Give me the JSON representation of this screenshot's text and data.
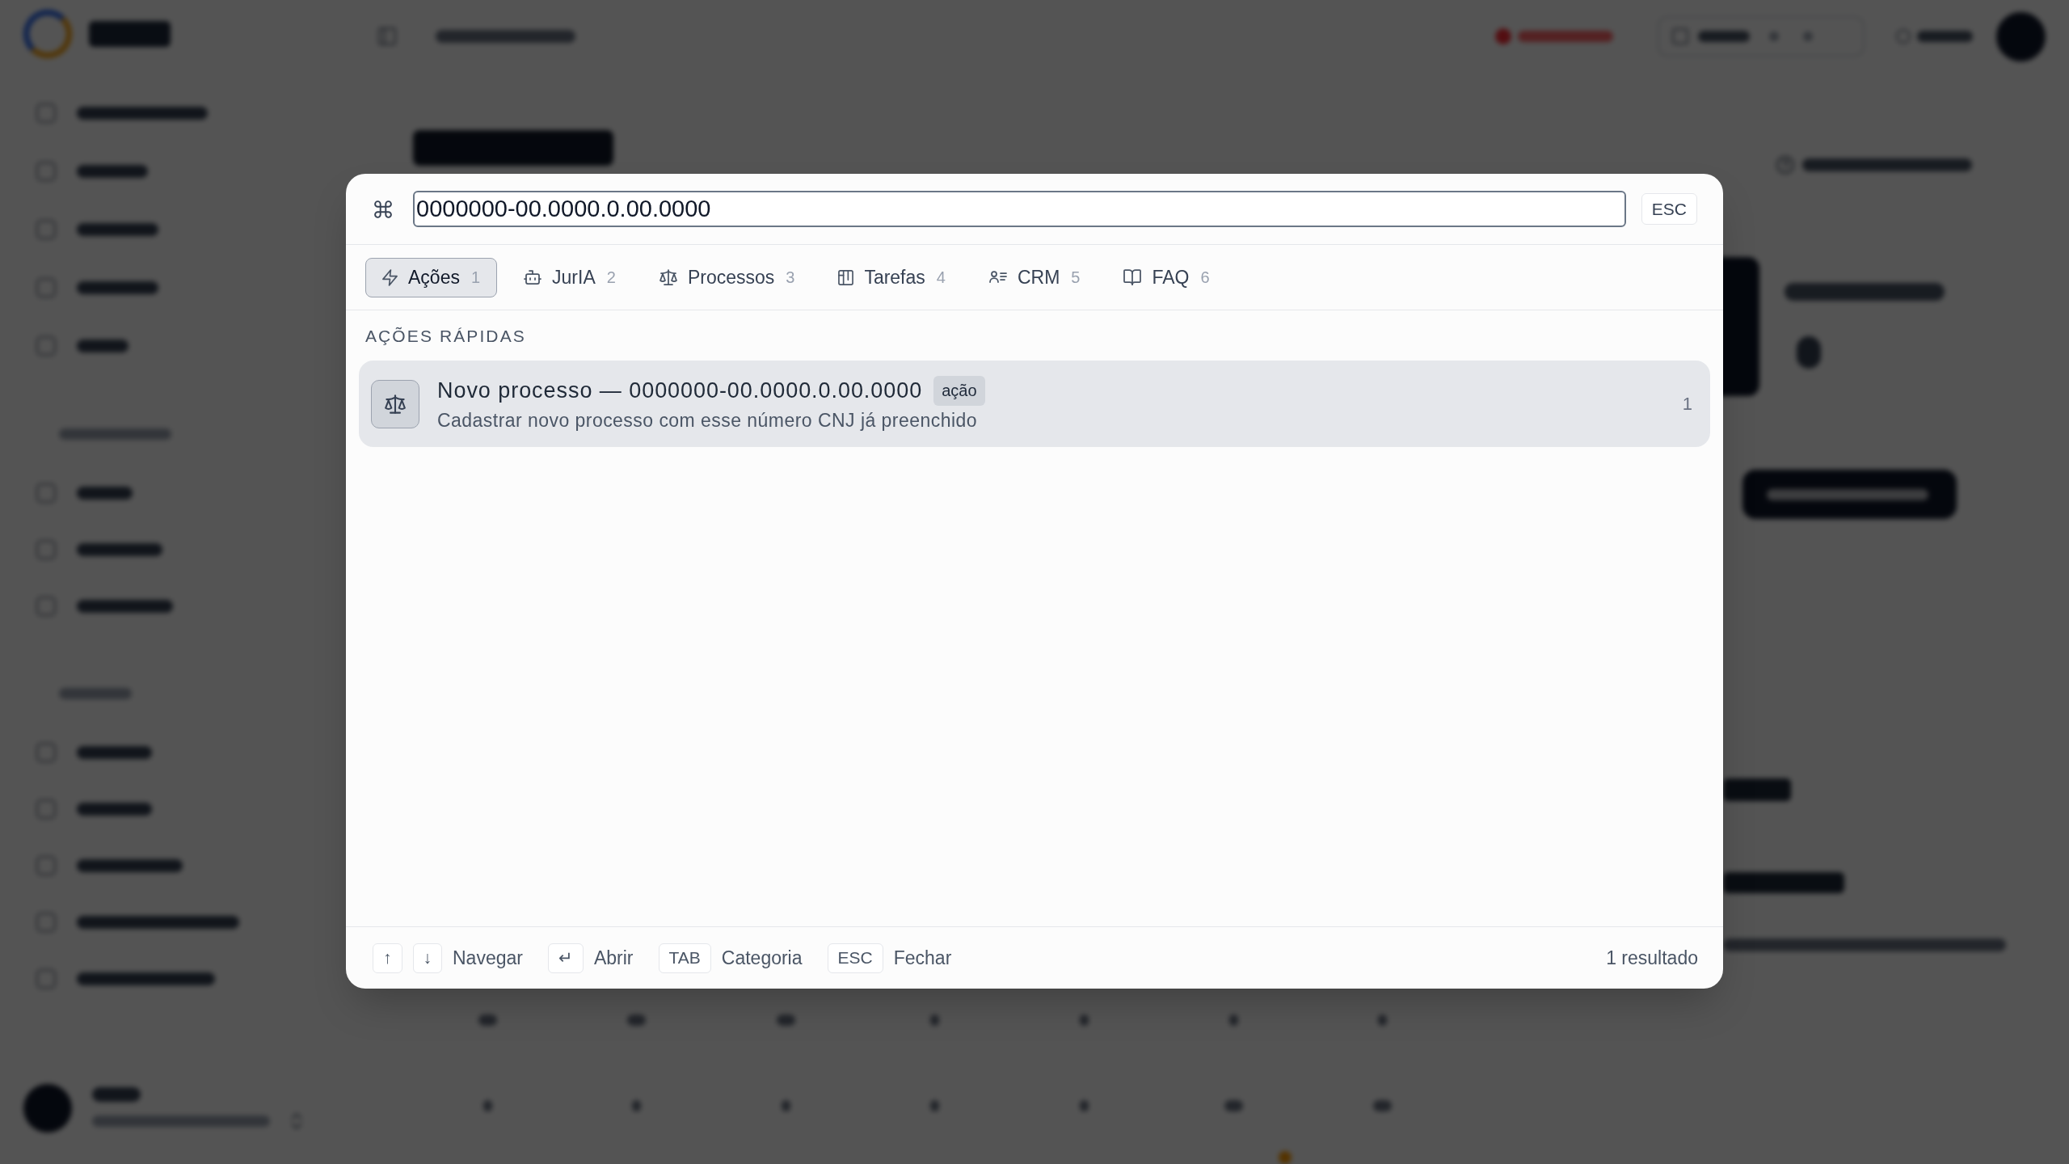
{
  "command_palette": {
    "search": {
      "value": "0000000-00.0000.0.00.0000"
    },
    "close_key": "ESC",
    "tabs": [
      {
        "kind": "actions",
        "label": "Ações",
        "shortcut": "1",
        "selected": true
      },
      {
        "kind": "assistant",
        "label": "JurIA",
        "shortcut": "2",
        "selected": false
      },
      {
        "kind": "processes",
        "label": "Processos",
        "shortcut": "3",
        "selected": false
      },
      {
        "kind": "tasks",
        "label": "Tarefas",
        "shortcut": "4",
        "selected": false
      },
      {
        "kind": "crm",
        "label": "CRM",
        "shortcut": "5",
        "selected": false
      },
      {
        "kind": "faq",
        "label": "FAQ",
        "shortcut": "6",
        "selected": false
      }
    ],
    "section_title": "AÇÕES RÁPIDAS",
    "results": [
      {
        "kind": "process",
        "title": "Novo processo — 0000000-00.0000.0.00.0000",
        "tag": "ação",
        "description": "Cadastrar novo processo com esse número CNJ já preenchido",
        "shortcut": "1",
        "selected": true
      }
    ],
    "footer": {
      "hints": [
        {
          "keys": [
            "↑",
            "↓"
          ],
          "label": "Navegar"
        },
        {
          "keys": [
            "↵"
          ],
          "label": "Abrir"
        },
        {
          "keys": [
            "TAB"
          ],
          "label": "Categoria"
        },
        {
          "keys": [
            "ESC"
          ],
          "label": "Fechar"
        }
      ],
      "result_count": "1 resultado"
    }
  }
}
